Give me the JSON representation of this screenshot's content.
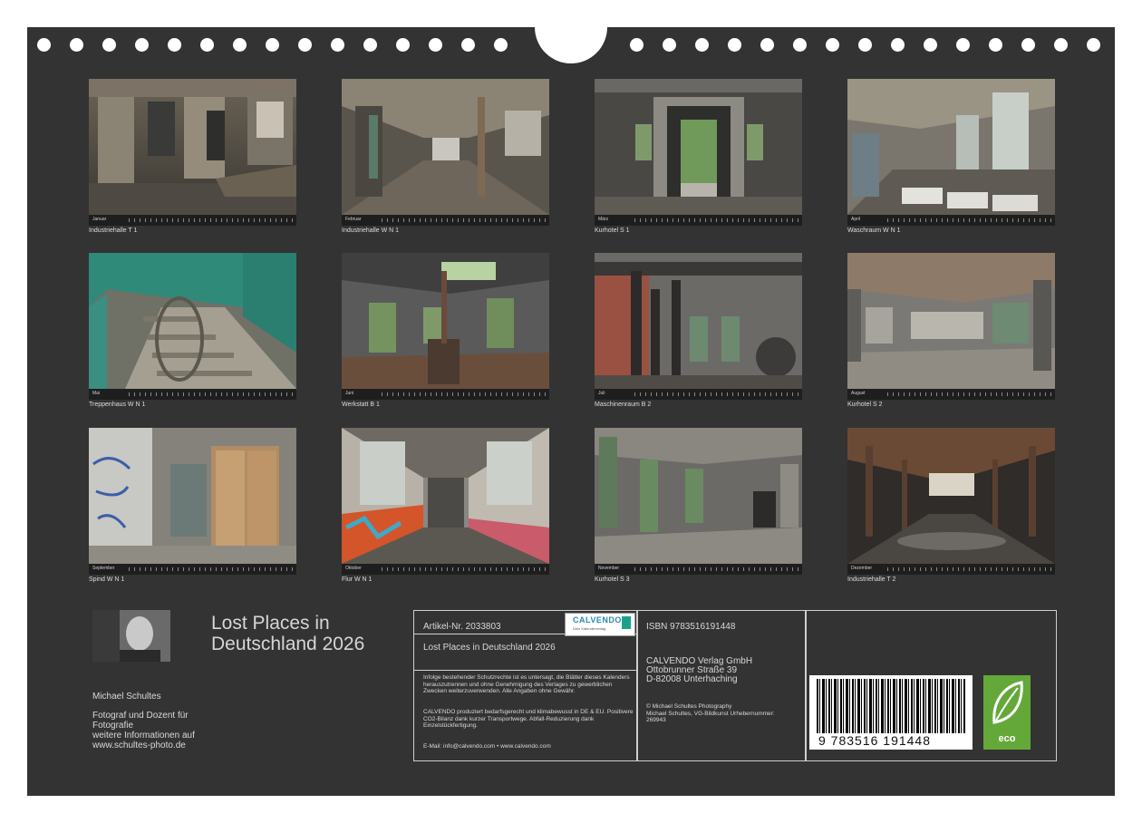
{
  "thumbs": [
    {
      "month": "Januar",
      "caption": "Industriehalle T 1"
    },
    {
      "month": "Februar",
      "caption": "Industriehalle W N 1"
    },
    {
      "month": "März",
      "caption": "Kurhotel S 1"
    },
    {
      "month": "April",
      "caption": "Waschraum W N 1"
    },
    {
      "month": "Mai",
      "caption": "Treppenhaus W N 1"
    },
    {
      "month": "Juni",
      "caption": "Werkstatt B 1"
    },
    {
      "month": "Juli",
      "caption": "Maschinenraum B 2"
    },
    {
      "month": "August",
      "caption": "Kurhotel S 2"
    },
    {
      "month": "September",
      "caption": "Spind W N 1"
    },
    {
      "month": "Oktober",
      "caption": "Flur W N 1"
    },
    {
      "month": "November",
      "caption": "Kurhotel S 3"
    },
    {
      "month": "Dezember",
      "caption": "Industriehalle T 2"
    }
  ],
  "title_line1": "Lost Places in",
  "title_line2": "Deutschland 2026",
  "author": {
    "name": "Michael Schultes",
    "line1": "Fotograf und Dozent für",
    "line2": "Fotografie",
    "line3": "weitere Informationen auf",
    "line4": "www.schultes-photo.de"
  },
  "info": {
    "artikel": "Artikel-Nr. 2033803",
    "calvendo_logo": "CALVENDO",
    "calvendo_sub": "Dein Kalenderverlag",
    "product_title": "Lost Places in Deutschland 2026",
    "legal1": "Infolge bestehender Schutzrechte ist es untersagt, die Blätter dieses Kalenders herauszutrennen und ohne Genehmigung des Verlages zu gewerblichen Zwecken weiterzuverwenden. Alle Angaben ohne Gewähr.",
    "legal2": "CALVENDO produziert bedarfsgerecht und klimabewusst in DE & EU. Positivere CO2-Bilanz dank kurzer Transportwege. Abfall-Reduzierung dank Einzelstückfertigung.",
    "contact": "E-Mail: info@calvendo.com • www.calvendo.com",
    "isbn": "ISBN 9783516191448",
    "publisher1": "CALVENDO Verlag GmbH",
    "publisher2": "Ottobrunner Straße 39",
    "publisher3": "D-82008 Unterhaching",
    "copyright1": "© Michael Schultes Photography",
    "copyright2": "Michael Schultes, VG-Bildkunst Urhebernummer:",
    "copyright3": "269943",
    "barcode_number": "9 783516 191448",
    "eco_label": "eco"
  },
  "colors": {
    "background": "#333333",
    "text": "#d8d8d8",
    "eco_green": "#64a83a"
  }
}
